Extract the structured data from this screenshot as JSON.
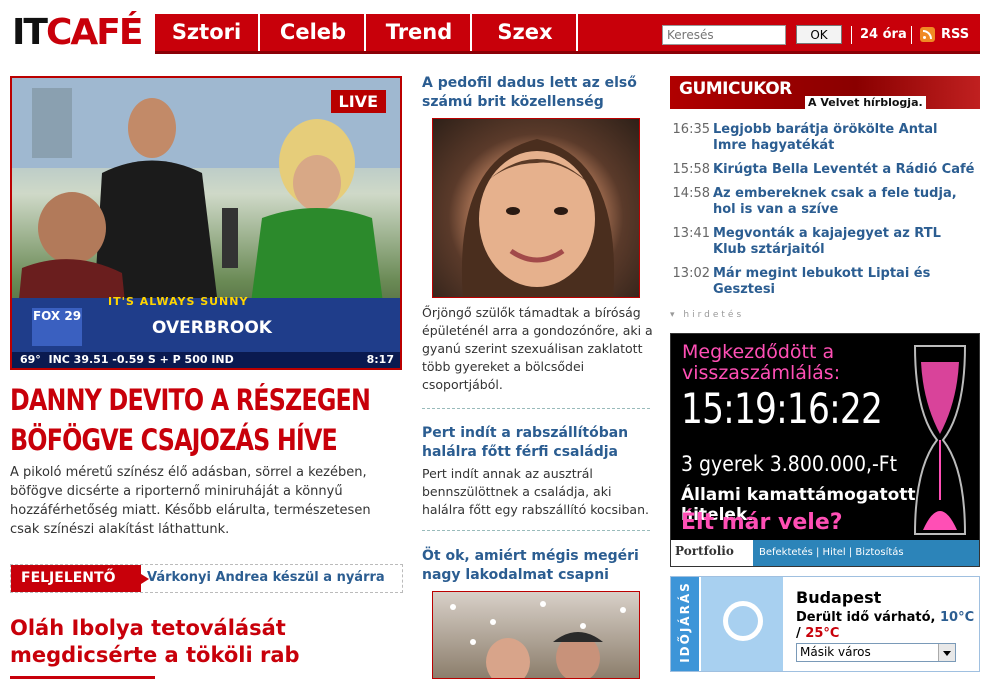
{
  "logo": {
    "part1": "IT",
    "part2": "CAFÉ"
  },
  "nav": {
    "items": [
      "Sztori",
      "Celeb",
      "Trend",
      "Szex"
    ]
  },
  "search": {
    "placeholder": "Keresés",
    "ok_label": "OK"
  },
  "header_links": {
    "hours": "24 óra",
    "rss": "RSS"
  },
  "main_story": {
    "live_badge": "LIVE",
    "tv_overlay": {
      "show": "IT'S ALWAYS SUNNY",
      "location": "OVERBROOK",
      "channel": "FOX 29",
      "ticker": "INC 39.51 -0.59   S + P 500 IND",
      "time": "8:17",
      "temp": "69°"
    },
    "headline": "DANNY DEVITO A RÉSZEGEN BÖFÖGVE CSAJOZÁS HÍVE",
    "text": "A pikoló méretű színész élő adásban, sörrel a kezében, böfögve dicsérte a riporternő miniruháját a könnyű hozzáférhetőség miatt. Később elárulta, természetesen csak színészi alakítást láthattunk."
  },
  "feljelento": {
    "label": "FELJELENTŐ",
    "link": "Várkonyi Andrea készül a nyárra"
  },
  "second_story": {
    "headline": "Oláh Ibolya tetoválását megdicsérte a tököli rab"
  },
  "middle": {
    "story1": {
      "title": "A pedofil dadus lett az első számú brit közellenség",
      "text": "Őrjöngő szülők támadtak a bíróság épületénél arra a gondozónőre, aki a gyanú szerint szexuálisan zaklatott több gyereket a bölcsődei csoportjából."
    },
    "story2": {
      "title": "Pert indít a rabszállítóban halálra főtt férfi családja",
      "text": "Pert indít annak az ausztrál bennszülöttnek a családja, aki halálra főtt egy rabszállító kocsiban."
    },
    "story3": {
      "title": "Öt ok, amiért mégis megéri nagy lakodalmat csapni"
    }
  },
  "gumicukor": {
    "title": "GUMICUKOR",
    "subtitle": "A Velvet hírblogja.",
    "items": [
      {
        "time": "16:35",
        "title": "Legjobb barátja örökölte Antal Imre hagyatékát"
      },
      {
        "time": "15:58",
        "title": "Kirúgta Bella Leventét a Rádió Café"
      },
      {
        "time": "14:58",
        "title": "Az embereknek csak a fele tudja, hol is van a szíve"
      },
      {
        "time": "13:41",
        "title": "Megvonták a kajajegyet az RTL Klub sztárjaitól"
      },
      {
        "time": "13:02",
        "title": "Már megint lebukott Liptai és Gesztesi"
      }
    ]
  },
  "ad": {
    "label": "hirdetés",
    "line1": "Megkezdődött a visszaszámlálás:",
    "countdown": "15:19:16:22",
    "line3": "3 gyerek 3.800.000,-Ft",
    "line4": "Állami kamattámogatott hitelek.",
    "line5": "Élt már vele?",
    "brand": "Portfolio",
    "links": "Befektetés | Hitel | Biztosítás"
  },
  "weather": {
    "label": "IDŐJÁRÁS",
    "city": "Budapest",
    "desc": "Derült idő várható,",
    "temp_low": "10°C",
    "sep": "/",
    "temp_high": "25°C",
    "select_value": "Másik város"
  },
  "colors": {
    "brand_red": "#c8000a",
    "link_blue": "#2b5d91",
    "ad_pink": "#ff4fb5",
    "weather_blue": "#3d95d8"
  }
}
